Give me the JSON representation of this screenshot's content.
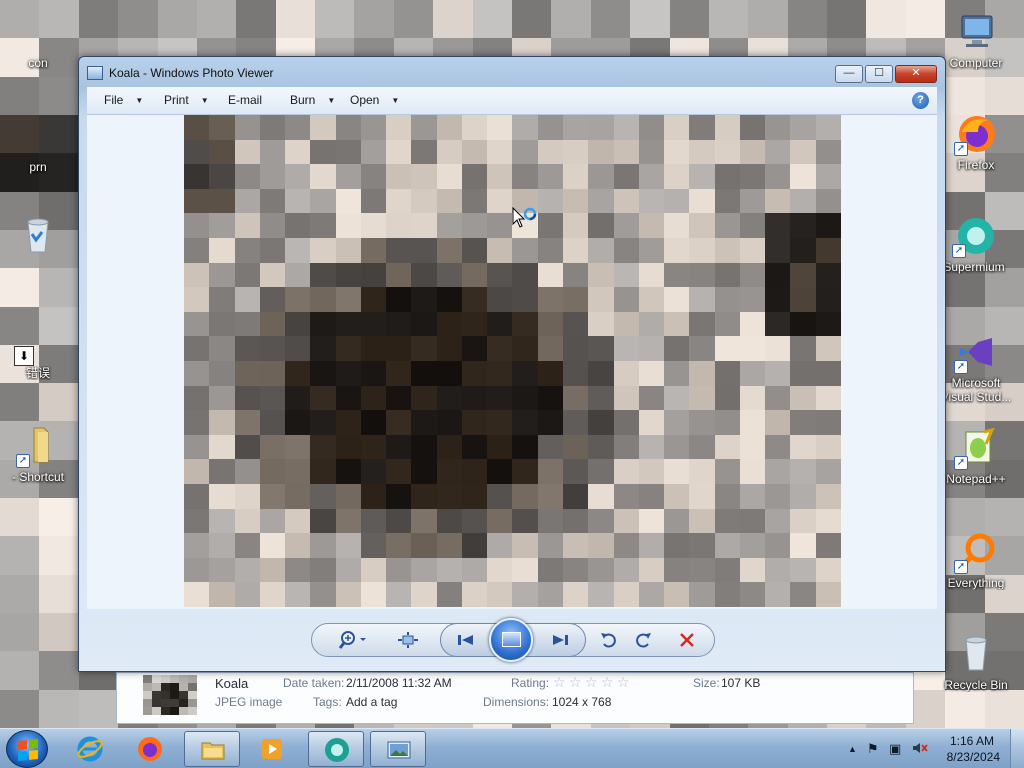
{
  "colors": {
    "accent": "#1f5fb8",
    "close_red": "#c7432a",
    "star_gold": "#d8a800"
  },
  "desktop": {
    "icons_left": [
      {
        "name": "con",
        "icon": "folder-icon"
      },
      {
        "name": "prn",
        "icon": "folder-icon"
      },
      {
        "name": "",
        "icon": "recycle-bin-icon"
      },
      {
        "name": "错误",
        "icon": "download-file-icon"
      },
      {
        "name": "- Shortcut",
        "icon": "folder-shortcut-icon"
      }
    ],
    "icons_right": [
      {
        "name": "Computer",
        "icon": "computer-icon"
      },
      {
        "name": "Firefox",
        "icon": "firefox-icon"
      },
      {
        "name": "Supermium",
        "icon": "supermium-icon"
      },
      {
        "name": "Microsoft Visual Stud...",
        "line1": "Microsoft",
        "line2": "Visual Stud...",
        "icon": "visual-studio-icon"
      },
      {
        "name": "Notepad++",
        "icon": "notepad-plus-plus-icon"
      },
      {
        "name": "Everything",
        "icon": "everything-search-icon"
      },
      {
        "name": "Recycle Bin",
        "icon": "recycle-bin-icon"
      }
    ]
  },
  "viewer": {
    "title": "Koala - Windows Photo Viewer",
    "menu": {
      "file": "File",
      "print": "Print",
      "email": "E-mail",
      "burn": "Burn",
      "open": "Open"
    },
    "help_glyph": "?",
    "window_buttons": {
      "minimize": "—",
      "maximize": "☐",
      "close": "✕"
    },
    "controls": {
      "zoom": "zoom-icon",
      "actual_size": "actual-size-icon",
      "previous": "previous-icon",
      "slideshow": "slideshow-icon",
      "next": "next-icon",
      "rotate_ccw": "rotate-counterclockwise-icon",
      "rotate_cw": "rotate-clockwise-icon",
      "delete": "delete-icon"
    }
  },
  "details": {
    "name": "Koala",
    "type": "JPEG image",
    "date_taken_label": "Date taken:",
    "date_taken": "2/11/2008 11:32 AM",
    "tags_label": "Tags:",
    "tags_value": "Add a tag",
    "rating_label": "Rating:",
    "rating": 0,
    "rating_max": 5,
    "dimensions_label": "Dimensions:",
    "dimensions": "1024 x 768",
    "size_label": "Size:",
    "size": "107 KB"
  },
  "taskbar": {
    "pinned": [
      "internet-explorer-icon",
      "firefox-icon",
      "file-explorer-icon",
      "media-player-icon",
      "supermium-icon",
      "photo-viewer-icon"
    ],
    "clock_time": "1:16 AM",
    "clock_date": "8/23/2024"
  }
}
